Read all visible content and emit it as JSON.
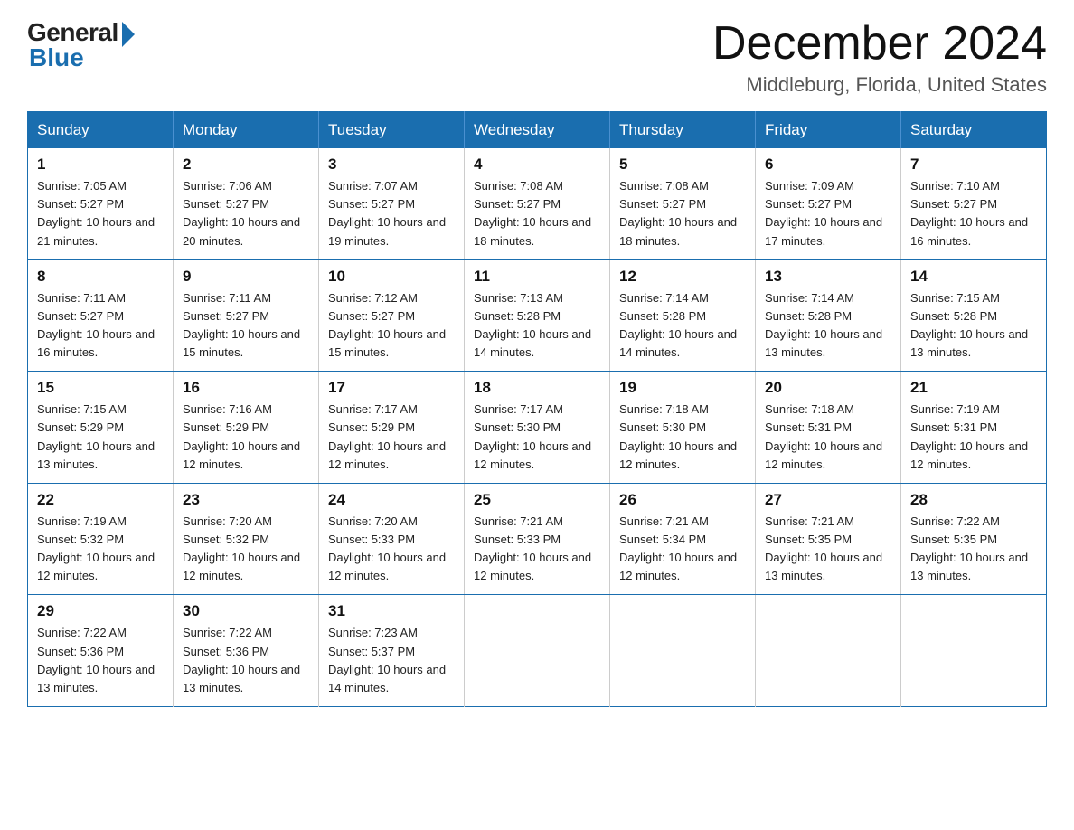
{
  "logo": {
    "general": "General",
    "blue": "Blue"
  },
  "title": {
    "month": "December 2024",
    "location": "Middleburg, Florida, United States"
  },
  "header": {
    "days": [
      "Sunday",
      "Monday",
      "Tuesday",
      "Wednesday",
      "Thursday",
      "Friday",
      "Saturday"
    ]
  },
  "weeks": [
    [
      {
        "day": "1",
        "sunrise": "7:05 AM",
        "sunset": "5:27 PM",
        "daylight": "10 hours and 21 minutes."
      },
      {
        "day": "2",
        "sunrise": "7:06 AM",
        "sunset": "5:27 PM",
        "daylight": "10 hours and 20 minutes."
      },
      {
        "day": "3",
        "sunrise": "7:07 AM",
        "sunset": "5:27 PM",
        "daylight": "10 hours and 19 minutes."
      },
      {
        "day": "4",
        "sunrise": "7:08 AM",
        "sunset": "5:27 PM",
        "daylight": "10 hours and 18 minutes."
      },
      {
        "day": "5",
        "sunrise": "7:08 AM",
        "sunset": "5:27 PM",
        "daylight": "10 hours and 18 minutes."
      },
      {
        "day": "6",
        "sunrise": "7:09 AM",
        "sunset": "5:27 PM",
        "daylight": "10 hours and 17 minutes."
      },
      {
        "day": "7",
        "sunrise": "7:10 AM",
        "sunset": "5:27 PM",
        "daylight": "10 hours and 16 minutes."
      }
    ],
    [
      {
        "day": "8",
        "sunrise": "7:11 AM",
        "sunset": "5:27 PM",
        "daylight": "10 hours and 16 minutes."
      },
      {
        "day": "9",
        "sunrise": "7:11 AM",
        "sunset": "5:27 PM",
        "daylight": "10 hours and 15 minutes."
      },
      {
        "day": "10",
        "sunrise": "7:12 AM",
        "sunset": "5:27 PM",
        "daylight": "10 hours and 15 minutes."
      },
      {
        "day": "11",
        "sunrise": "7:13 AM",
        "sunset": "5:28 PM",
        "daylight": "10 hours and 14 minutes."
      },
      {
        "day": "12",
        "sunrise": "7:14 AM",
        "sunset": "5:28 PM",
        "daylight": "10 hours and 14 minutes."
      },
      {
        "day": "13",
        "sunrise": "7:14 AM",
        "sunset": "5:28 PM",
        "daylight": "10 hours and 13 minutes."
      },
      {
        "day": "14",
        "sunrise": "7:15 AM",
        "sunset": "5:28 PM",
        "daylight": "10 hours and 13 minutes."
      }
    ],
    [
      {
        "day": "15",
        "sunrise": "7:15 AM",
        "sunset": "5:29 PM",
        "daylight": "10 hours and 13 minutes."
      },
      {
        "day": "16",
        "sunrise": "7:16 AM",
        "sunset": "5:29 PM",
        "daylight": "10 hours and 12 minutes."
      },
      {
        "day": "17",
        "sunrise": "7:17 AM",
        "sunset": "5:29 PM",
        "daylight": "10 hours and 12 minutes."
      },
      {
        "day": "18",
        "sunrise": "7:17 AM",
        "sunset": "5:30 PM",
        "daylight": "10 hours and 12 minutes."
      },
      {
        "day": "19",
        "sunrise": "7:18 AM",
        "sunset": "5:30 PM",
        "daylight": "10 hours and 12 minutes."
      },
      {
        "day": "20",
        "sunrise": "7:18 AM",
        "sunset": "5:31 PM",
        "daylight": "10 hours and 12 minutes."
      },
      {
        "day": "21",
        "sunrise": "7:19 AM",
        "sunset": "5:31 PM",
        "daylight": "10 hours and 12 minutes."
      }
    ],
    [
      {
        "day": "22",
        "sunrise": "7:19 AM",
        "sunset": "5:32 PM",
        "daylight": "10 hours and 12 minutes."
      },
      {
        "day": "23",
        "sunrise": "7:20 AM",
        "sunset": "5:32 PM",
        "daylight": "10 hours and 12 minutes."
      },
      {
        "day": "24",
        "sunrise": "7:20 AM",
        "sunset": "5:33 PM",
        "daylight": "10 hours and 12 minutes."
      },
      {
        "day": "25",
        "sunrise": "7:21 AM",
        "sunset": "5:33 PM",
        "daylight": "10 hours and 12 minutes."
      },
      {
        "day": "26",
        "sunrise": "7:21 AM",
        "sunset": "5:34 PM",
        "daylight": "10 hours and 12 minutes."
      },
      {
        "day": "27",
        "sunrise": "7:21 AM",
        "sunset": "5:35 PM",
        "daylight": "10 hours and 13 minutes."
      },
      {
        "day": "28",
        "sunrise": "7:22 AM",
        "sunset": "5:35 PM",
        "daylight": "10 hours and 13 minutes."
      }
    ],
    [
      {
        "day": "29",
        "sunrise": "7:22 AM",
        "sunset": "5:36 PM",
        "daylight": "10 hours and 13 minutes."
      },
      {
        "day": "30",
        "sunrise": "7:22 AM",
        "sunset": "5:36 PM",
        "daylight": "10 hours and 13 minutes."
      },
      {
        "day": "31",
        "sunrise": "7:23 AM",
        "sunset": "5:37 PM",
        "daylight": "10 hours and 14 minutes."
      },
      null,
      null,
      null,
      null
    ]
  ]
}
